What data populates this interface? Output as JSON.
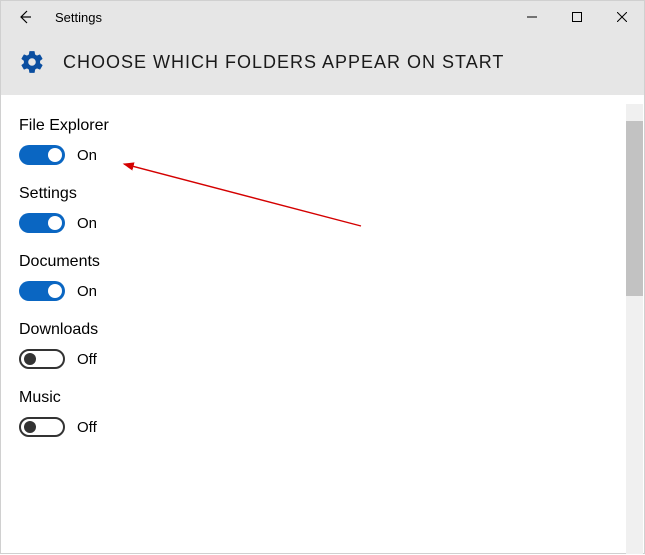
{
  "window": {
    "title": "Settings"
  },
  "header": {
    "page_title": "CHOOSE WHICH FOLDERS APPEAR ON START"
  },
  "settings": [
    {
      "label": "File Explorer",
      "on": true,
      "state_text": "On"
    },
    {
      "label": "Settings",
      "on": true,
      "state_text": "On"
    },
    {
      "label": "Documents",
      "on": true,
      "state_text": "On"
    },
    {
      "label": "Downloads",
      "on": false,
      "state_text": "Off"
    },
    {
      "label": "Music",
      "on": false,
      "state_text": "Off"
    }
  ],
  "colors": {
    "accent": "#0a66c2",
    "header_bg": "#e6e6e6"
  }
}
